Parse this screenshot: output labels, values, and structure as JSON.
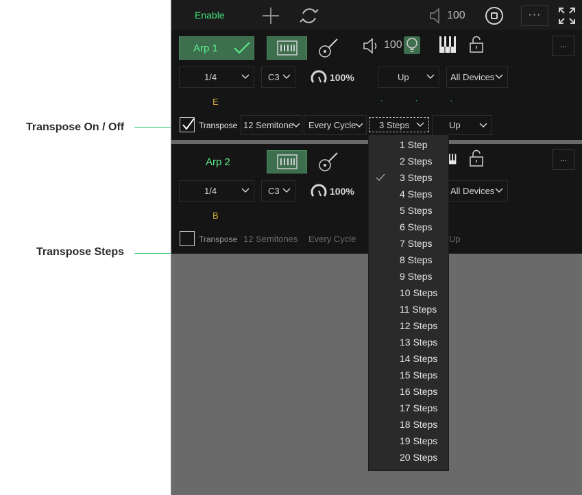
{
  "callouts": {
    "transpose_onoff": "Transpose On / Off",
    "transpose_steps": "Transpose Steps"
  },
  "toolbar": {
    "enable_label": "Enable",
    "volume": "100",
    "more_label": "···"
  },
  "arp1": {
    "name": "Arp 1",
    "volume": "100",
    "rate": "1/4",
    "root": "C3",
    "velocity": "100%",
    "direction": "Up",
    "device": "All Devices",
    "note": "E",
    "transpose_label": "Transpose",
    "semitones": "12 Semitones",
    "cycle": "Every Cycle",
    "steps": "3 Steps",
    "transpose_direction": "Up",
    "more_label": "..."
  },
  "arp2": {
    "name": "Arp 2",
    "rate": "1/4",
    "root": "C3",
    "velocity": "100%",
    "device": "All Devices",
    "note": "B",
    "transpose_label": "Transpose",
    "semitones": "12 Semitones",
    "cycle": "Every Cycle",
    "transpose_direction": "Up",
    "more_label": "..."
  },
  "steps_menu": {
    "selected": "3 Steps",
    "items": [
      "1 Step",
      "2 Steps",
      "3 Steps",
      "4 Steps",
      "5 Steps",
      "6 Steps",
      "7 Steps",
      "8 Steps",
      "9 Steps",
      "10 Steps",
      "11 Steps",
      "12 Steps",
      "13 Steps",
      "14 Steps",
      "15 Steps",
      "16 Steps",
      "17 Steps",
      "18 Steps",
      "19 Steps",
      "20 Steps"
    ]
  },
  "colors": {
    "accent_green": "#3fe07a",
    "button_green": "#3d6e4e",
    "note_yellow": "#c8a93a",
    "panel_bg": "#151515"
  }
}
